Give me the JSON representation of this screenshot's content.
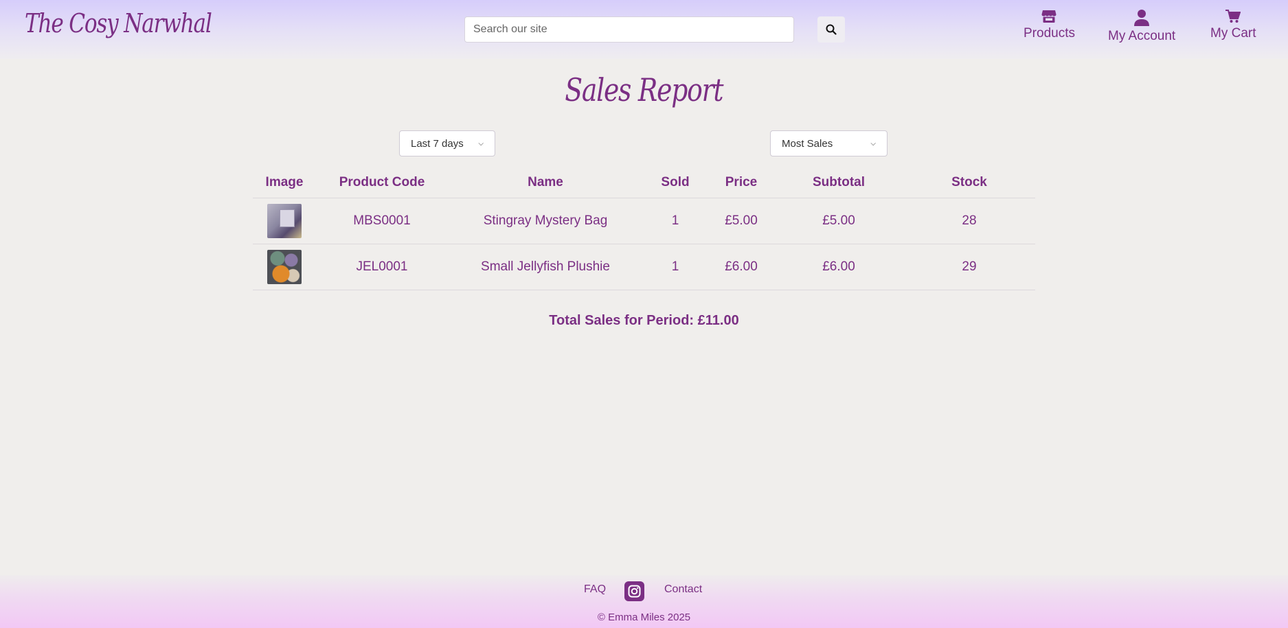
{
  "header": {
    "logo": "The Cosy Narwhal",
    "search_placeholder": "Search our site",
    "nav": {
      "products": "Products",
      "account": "My Account",
      "cart": "My Cart"
    }
  },
  "page": {
    "title": "Sales Report"
  },
  "filters": {
    "period": "Last 7 days",
    "sort": "Most Sales"
  },
  "table": {
    "headers": {
      "image": "Image",
      "code": "Product Code",
      "name": "Name",
      "sold": "Sold",
      "price": "Price",
      "subtotal": "Subtotal",
      "stock": "Stock"
    },
    "rows": [
      {
        "code": "MBS0001",
        "name": "Stingray Mystery Bag",
        "sold": "1",
        "price": "£5.00",
        "subtotal": "£5.00",
        "stock": "28"
      },
      {
        "code": "JEL0001",
        "name": "Small Jellyfish Plushie",
        "sold": "1",
        "price": "£6.00",
        "subtotal": "£6.00",
        "stock": "29"
      }
    ]
  },
  "summary": {
    "total": "Total Sales for Period: £11.00"
  },
  "footer": {
    "faq": "FAQ",
    "contact": "Contact",
    "copyright": "© Emma Miles 2025"
  },
  "colors": {
    "brand": "#7b2f84",
    "background": "#f0eeec"
  }
}
